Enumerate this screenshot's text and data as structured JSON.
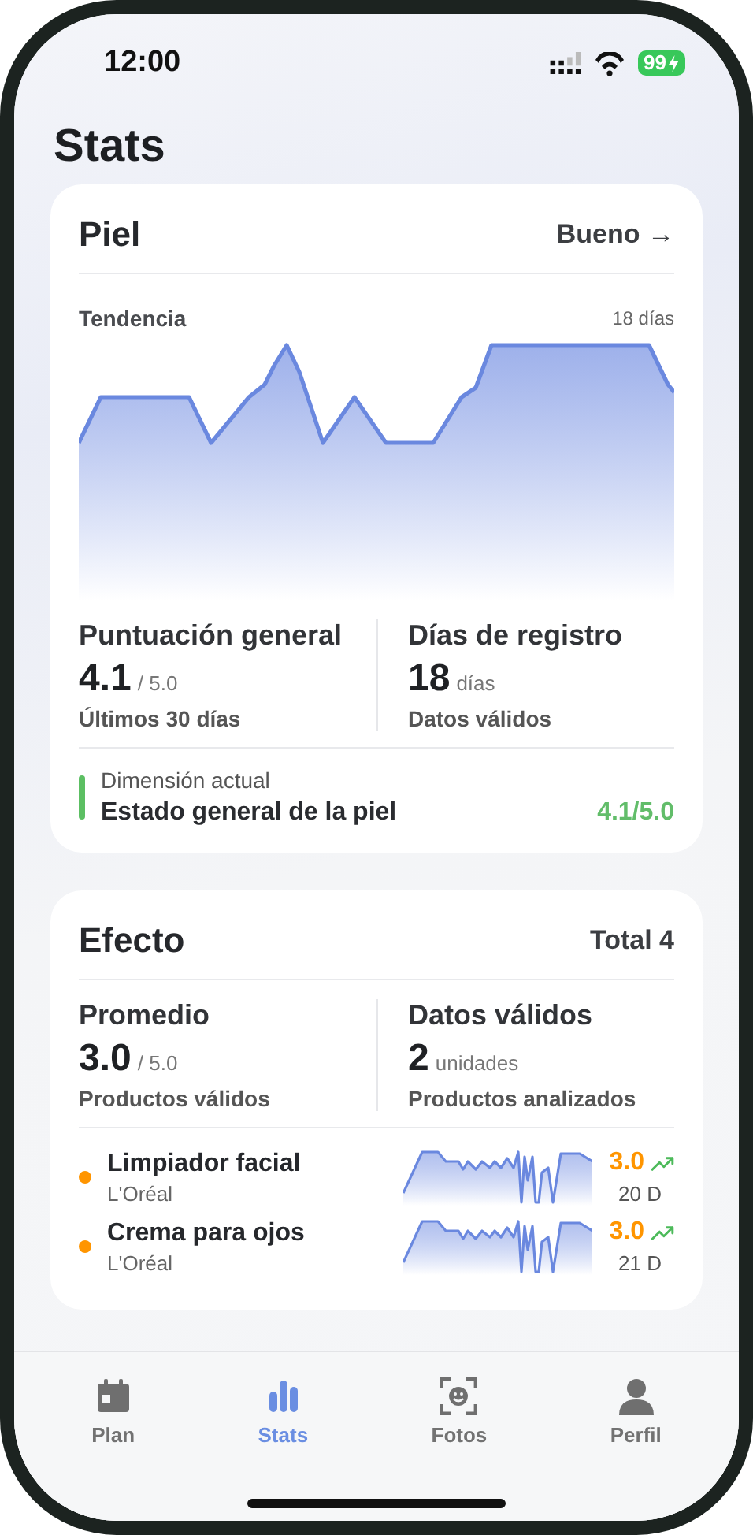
{
  "status_bar": {
    "time": "12:00",
    "battery": "99"
  },
  "title": "Stats",
  "skin": {
    "title": "Piel",
    "rating": "Bueno →",
    "trend_label": "Tendencia",
    "period": "18 días",
    "metrics": [
      {
        "label": "Puntuación general",
        "value": "4.1",
        "unit": "/ 5.0",
        "note": "Últimos 30 días"
      },
      {
        "label": "Días de registro",
        "value": "18",
        "unit": "días",
        "note": "Datos válidos"
      }
    ],
    "dimension": {
      "label": "Dimensión actual",
      "name": "Estado general de la piel",
      "score": "4.1/5.0"
    }
  },
  "effect": {
    "title": "Efecto",
    "total": "Total 4",
    "metrics": [
      {
        "label": "Promedio",
        "value": "3.0",
        "unit": "/ 5.0",
        "note": "Productos válidos"
      },
      {
        "label": "Datos válidos",
        "value": "2",
        "unit": "unidades",
        "note": "Productos analizados"
      }
    ],
    "products": [
      {
        "name": "Limpiador facial",
        "brand": "L'Oréal",
        "score": "3.0",
        "days": "20 D",
        "color": "#ff9500"
      },
      {
        "name": "Crema para ojos",
        "brand": "L'Oréal",
        "score": "3.0",
        "days": "21 D",
        "color": "#ff9500"
      }
    ]
  },
  "tabs": [
    {
      "label": "Plan",
      "selected": false
    },
    {
      "label": "Stats",
      "selected": true
    },
    {
      "label": "Fotos",
      "selected": false
    },
    {
      "label": "Perfil",
      "selected": false
    }
  ]
}
